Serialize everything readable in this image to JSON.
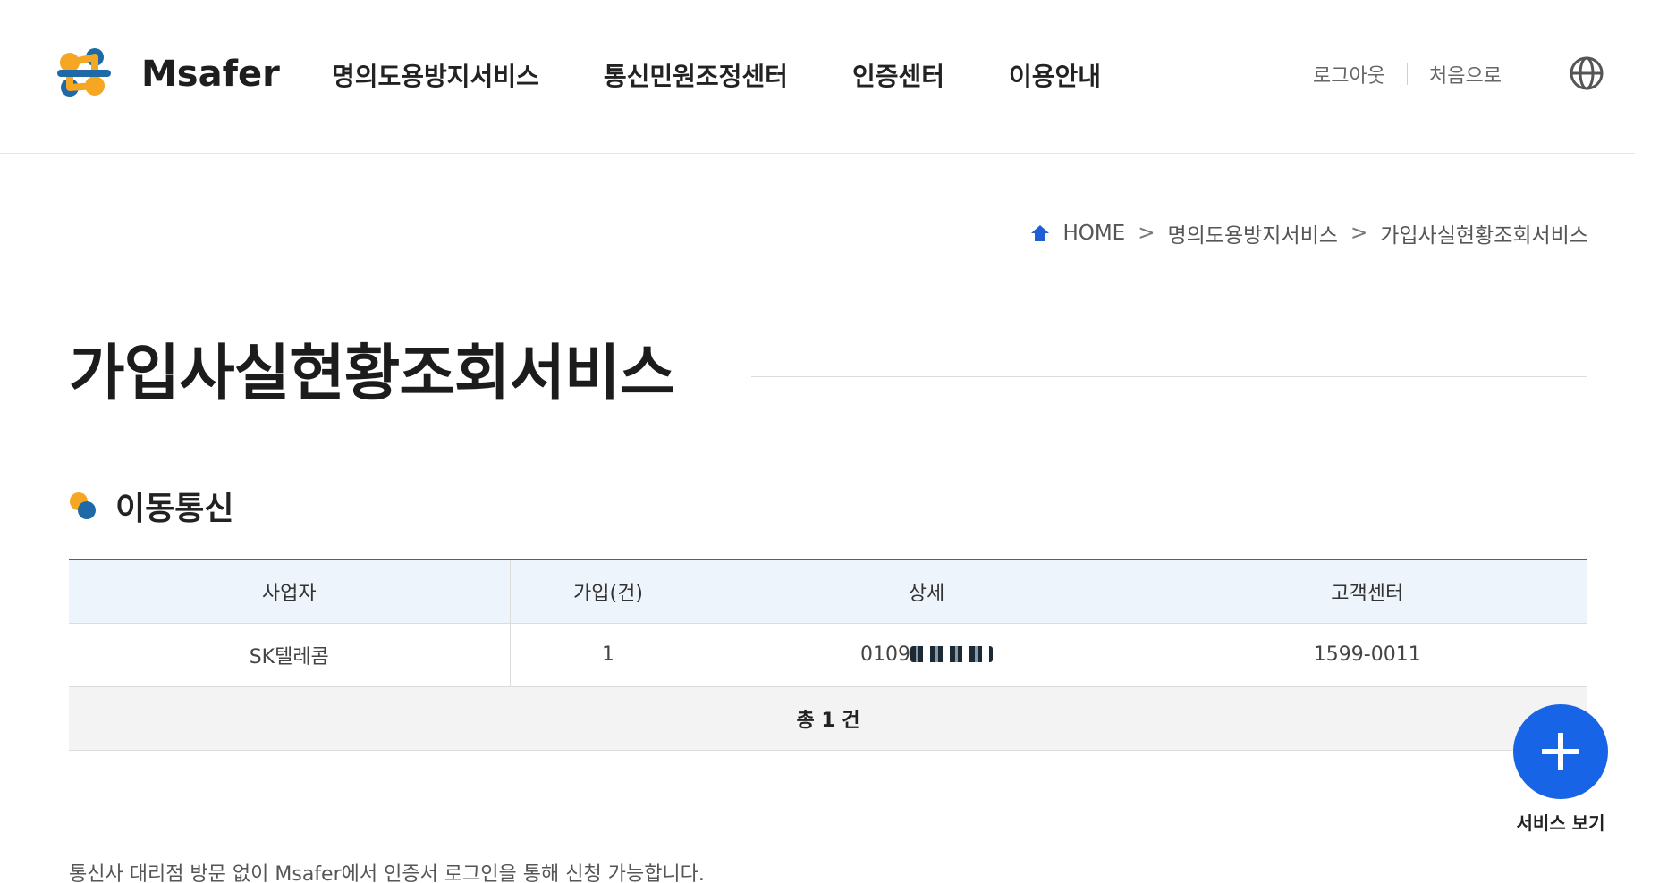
{
  "brand": {
    "logo_text": "Msafer",
    "colors": {
      "orange": "#f5a623",
      "blue": "#1e6aa8",
      "dark": "#1e1e1e"
    }
  },
  "nav": {
    "items": [
      {
        "label": "명의도용방지서비스"
      },
      {
        "label": "통신민원조정센터"
      },
      {
        "label": "인증센터"
      },
      {
        "label": "이용안내"
      }
    ]
  },
  "util": {
    "logout": "로그아웃",
    "home": "처음으로",
    "language_icon": "globe-icon"
  },
  "breadcrumb": {
    "home": "HOME",
    "items": [
      "명의도용방지서비스",
      "가입사실현황조회서비스"
    ],
    "separator": ">"
  },
  "page": {
    "title": "가입사실현황조회서비스"
  },
  "section": {
    "title": "이동통신"
  },
  "table": {
    "headers": [
      "사업자",
      "가입(건)",
      "상세",
      "고객센터"
    ],
    "rows": [
      {
        "carrier": "SK텔레콤",
        "count": "1",
        "detail_prefix": "0109",
        "support": "1599-0011"
      }
    ],
    "total": "총 1 건"
  },
  "fab": {
    "label": "서비스 보기",
    "icon": "plus-icon",
    "color": "#1765e6"
  },
  "footer_note": "통신사 대리점 방문 없이 Msafer에서 인증서 로그인을 통해 신청 가능합니다."
}
